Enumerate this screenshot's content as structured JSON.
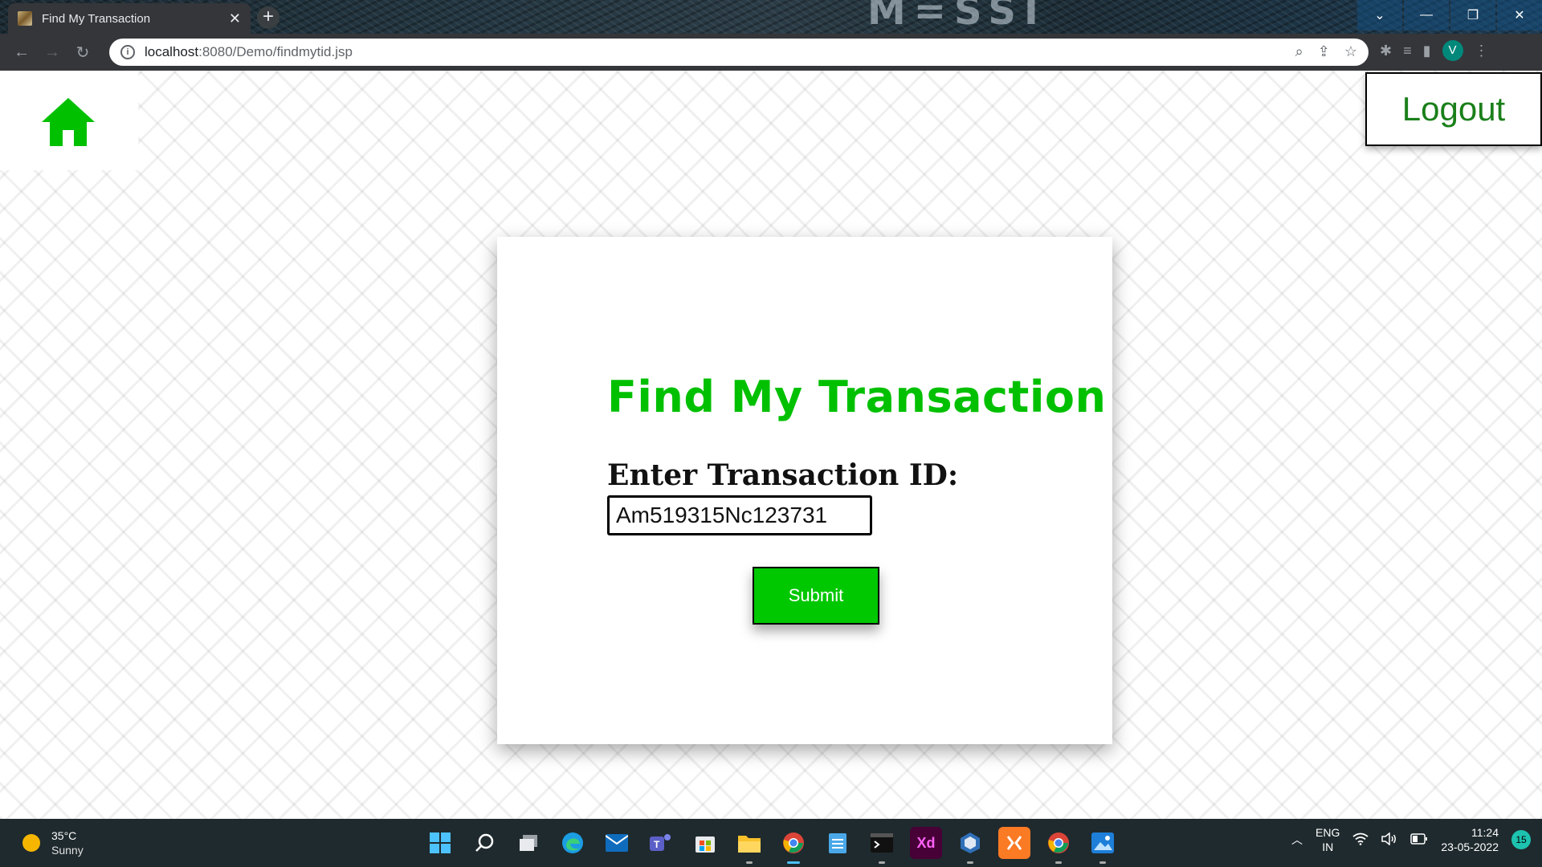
{
  "browser": {
    "tab_title": "Find My Transaction",
    "tab_close": "✕",
    "new_tab": "+",
    "url_host": "localhost",
    "url_path": ":8080/Demo/findmytid.jsp",
    "profile_initial": "V",
    "window_brand": "M=SSI",
    "window_controls": {
      "chevron": "⌄",
      "minimize": "—",
      "restore": "❐",
      "close": "✕"
    }
  },
  "page": {
    "logout_label": "Logout",
    "title": "Find My Transaction",
    "field_label": "Enter Transaction ID:",
    "transaction_id_value": "Am519315Nc123731",
    "submit_label": "Submit",
    "accent_color": "#00c000"
  },
  "taskbar": {
    "weather_temp": "35°C",
    "weather_condition": "Sunny",
    "lang_primary": "ENG",
    "lang_secondary": "IN",
    "time": "11:24",
    "date": "23-05-2022",
    "notification_count": "15",
    "apps": [
      "windows-start",
      "search",
      "task-view",
      "edge",
      "mail",
      "teams",
      "store",
      "file-explorer",
      "chrome",
      "notepad",
      "terminal",
      "adobe-xd",
      "virtualbox",
      "xampp",
      "chrome-profile",
      "photos"
    ],
    "xd_label": "Xd"
  }
}
